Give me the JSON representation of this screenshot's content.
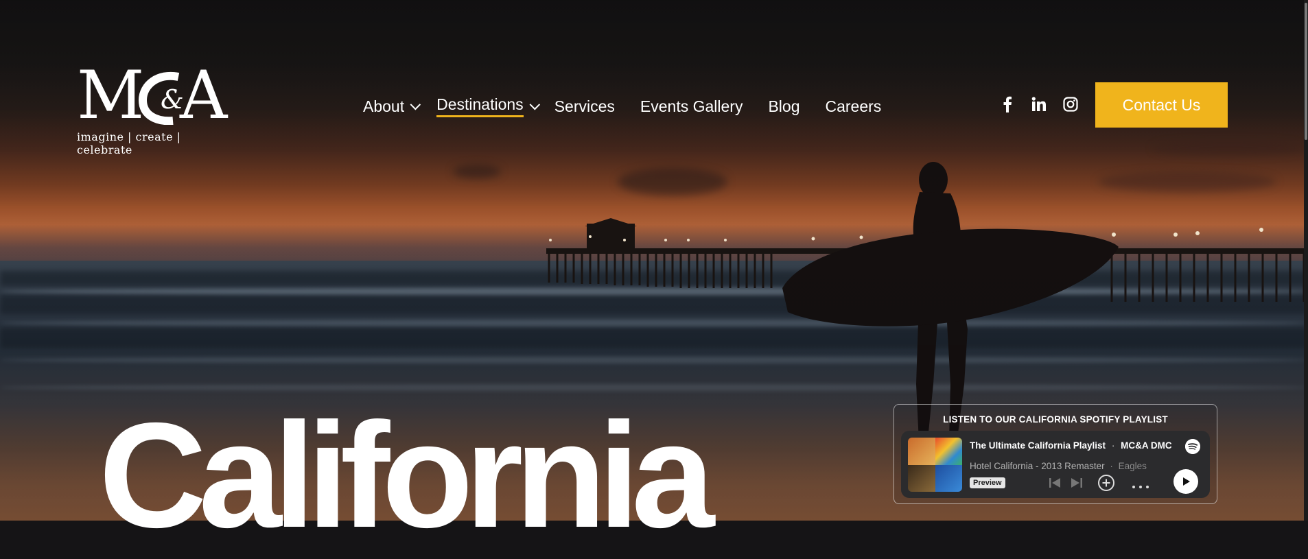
{
  "logo": {
    "mark": "MC&A",
    "tagline": "imagine | create | celebrate"
  },
  "nav": {
    "items": [
      {
        "label": "About",
        "dropdown": true,
        "active": false
      },
      {
        "label": "Destinations",
        "dropdown": true,
        "active": true
      },
      {
        "label": "Services",
        "dropdown": false,
        "active": false
      },
      {
        "label": "Events Gallery",
        "dropdown": false,
        "active": false
      },
      {
        "label": "Blog",
        "dropdown": false,
        "active": false
      },
      {
        "label": "Careers",
        "dropdown": false,
        "active": false
      }
    ]
  },
  "social": {
    "icons": [
      "facebook-icon",
      "linkedin-icon",
      "instagram-icon"
    ]
  },
  "cta": {
    "label": "Contact Us"
  },
  "hero": {
    "title": "California"
  },
  "playlist": {
    "heading": "LISTEN TO OUR CALIFORNIA SPOTIFY PLAYLIST",
    "title": "The Ultimate California Playlist",
    "owner": "MC&A DMC",
    "separator": "·",
    "track": "Hotel California - 2013 Remaster",
    "artist": "Eagles",
    "badge": "Preview"
  },
  "colors": {
    "accent": "#f0b41c",
    "text": "#ffffff",
    "embed_bg": "#2b2b2d"
  }
}
